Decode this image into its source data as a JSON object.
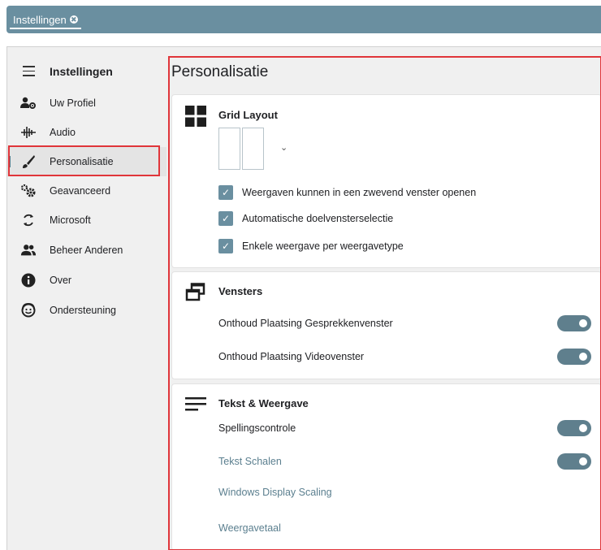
{
  "tabbar": {
    "tab_label": "Instellingen",
    "tab_close_glyph": "✖"
  },
  "sidebar": {
    "title": "Instellingen",
    "items": [
      {
        "label": "Uw Profiel",
        "icon": "user-settings-icon"
      },
      {
        "label": "Audio",
        "icon": "audio-wave-icon"
      },
      {
        "label": "Personalisatie",
        "icon": "brush-icon",
        "active": true
      },
      {
        "label": "Geavanceerd",
        "icon": "gears-icon"
      },
      {
        "label": "Microsoft",
        "icon": "sync-icon"
      },
      {
        "label": "Beheer Anderen",
        "icon": "users-icon"
      },
      {
        "label": "Over",
        "icon": "info-icon"
      },
      {
        "label": "Ondersteuning",
        "icon": "support-icon"
      }
    ]
  },
  "content": {
    "title": "Personalisatie",
    "grid_layout": {
      "title": "Grid Layout",
      "chevron": "⌄",
      "options": [
        {
          "label": "Weergaven kunnen in een zwevend venster openen",
          "checked": true
        },
        {
          "label": "Automatische doelvensterselectie",
          "checked": true
        },
        {
          "label": "Enkele weergave per weergavetype",
          "checked": true
        }
      ]
    },
    "vensters": {
      "title": "Vensters",
      "rows": [
        {
          "label": "Onthoud Plaatsing Gesprekkenvenster",
          "on": true
        },
        {
          "label": "Onthoud Plaatsing Videovenster",
          "on": true
        }
      ]
    },
    "tekst": {
      "title": "Tekst & Weergave",
      "rows": [
        {
          "label": "Spellingscontrole",
          "on": true
        },
        {
          "label": "Tekst Schalen",
          "on": true
        },
        {
          "label": "Windows Display Scaling"
        },
        {
          "label": "Weergavetaal"
        }
      ]
    }
  },
  "colors": {
    "accent": "#6a8fa0",
    "toggle_on": "#5f7f8d",
    "highlight_border": "#e0353a"
  }
}
